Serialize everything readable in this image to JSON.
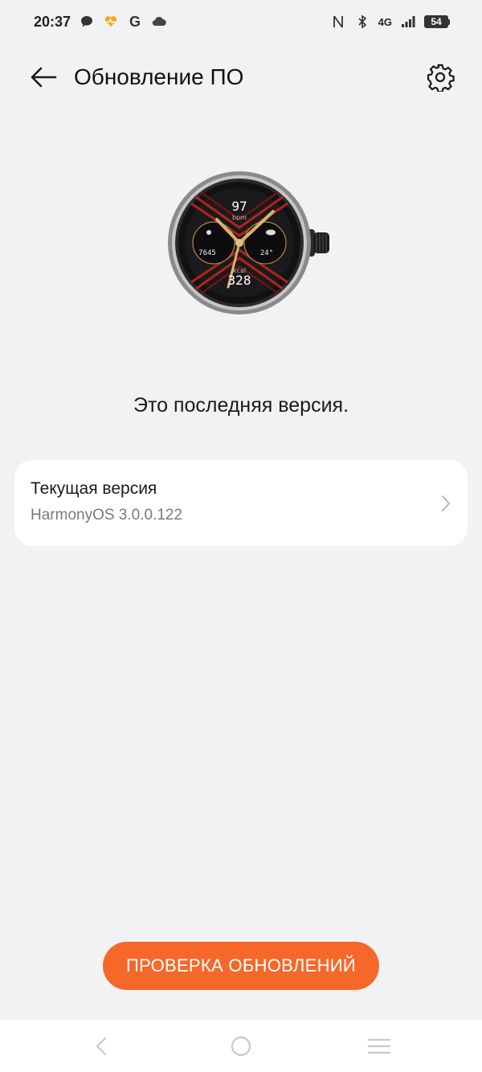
{
  "status_bar": {
    "time": "20:37",
    "network": "4G",
    "battery": "54",
    "icons": [
      "chat-bubble-icon",
      "health-heart-icon",
      "google-icon",
      "cloud-icon",
      "nfc-icon",
      "bluetooth-icon",
      "signal-icon",
      "battery-icon"
    ],
    "google_letter": "G"
  },
  "header": {
    "title": "Обновление ПО"
  },
  "watch": {
    "heart_rate": "97",
    "heart_rate_unit": "bpm",
    "steps": "7645",
    "temperature": "24°",
    "calories_unit": "kcal",
    "calories": "328"
  },
  "status_message": "Это последняя версия.",
  "version": {
    "label": "Текущая версия",
    "value": "HarmonyOS 3.0.0.122"
  },
  "check_button": {
    "label": "ПРОВЕРКА ОБНОВЛЕНИЙ"
  },
  "colors": {
    "background": "#f1f2f4",
    "accent": "#f5682a",
    "card": "#ffffff",
    "secondary_text": "#7a7a7a"
  }
}
